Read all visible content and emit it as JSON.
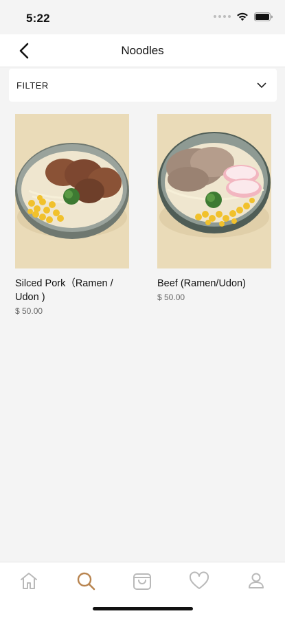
{
  "status_bar": {
    "time": "5:22"
  },
  "nav": {
    "title": "Noodles"
  },
  "filter": {
    "label": "FILTER"
  },
  "products": [
    {
      "name": "Silced Pork（Ramen / Udon )",
      "price": "$ 50.00"
    },
    {
      "name": "Beef (Ramen/Udon)",
      "price": "$ 50.00"
    }
  ],
  "tab_bar": {
    "items": [
      "home-icon",
      "search-icon",
      "cart-icon",
      "heart-icon",
      "profile-icon"
    ],
    "active_color": "#b8844f",
    "inactive_color": "#b9b9b9"
  }
}
